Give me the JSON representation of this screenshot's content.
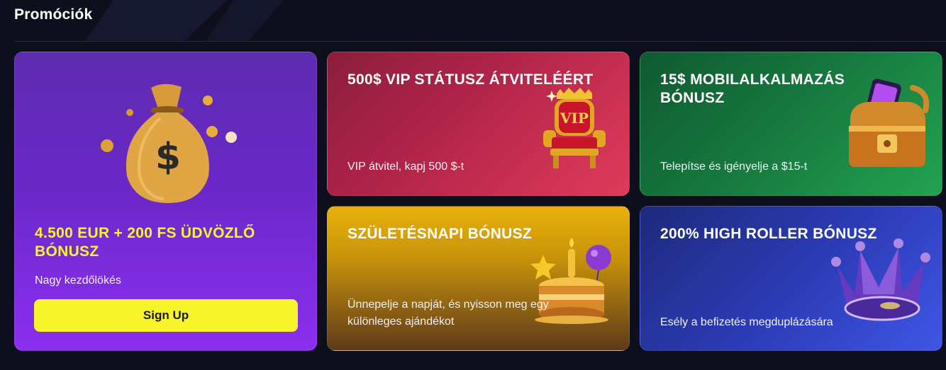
{
  "page": {
    "section_title": "Promóciók",
    "colors": {
      "background": "#0e0f1d",
      "accent_yellow": "#f7f52a",
      "welcome_gradient": "#6a28c8",
      "vip_gradient": "#b02349",
      "mobile_gradient": "#177a3f",
      "birthday_gradient": "#e8b10a",
      "highroller_gradient": "#2d3cb8"
    }
  },
  "cards": {
    "welcome": {
      "title": "4.500 EUR + 200 FS ÜDVÖZLŐ BÓNUSZ",
      "description": "Nagy kezdőlökés",
      "button_label": "Sign Up",
      "icon": "money-bag-icon"
    },
    "vip": {
      "title": "500$ VIP STÁTUSZ ÁTVITELÉÉRT",
      "description": "VIP átvitel, kapj 500 $-t",
      "icon": "vip-throne-icon",
      "badge_text": "VIP"
    },
    "mobile": {
      "title": "15$ MOBILALKALMAZÁS BÓNUSZ",
      "description": "Telepítse és igényelje a $15-t",
      "icon": "treasure-chest-phone-icon"
    },
    "birthday": {
      "title": "SZÜLETÉSNAPI BÓNUSZ",
      "description": "Ünnepelje a napját, és nyisson meg egy különleges ajándékot",
      "icon": "birthday-cake-icon"
    },
    "highroller": {
      "title": "200% HIGH ROLLER BÓNUSZ",
      "description": "Esély a befizetés megduplázására",
      "icon": "crown-icon"
    }
  }
}
